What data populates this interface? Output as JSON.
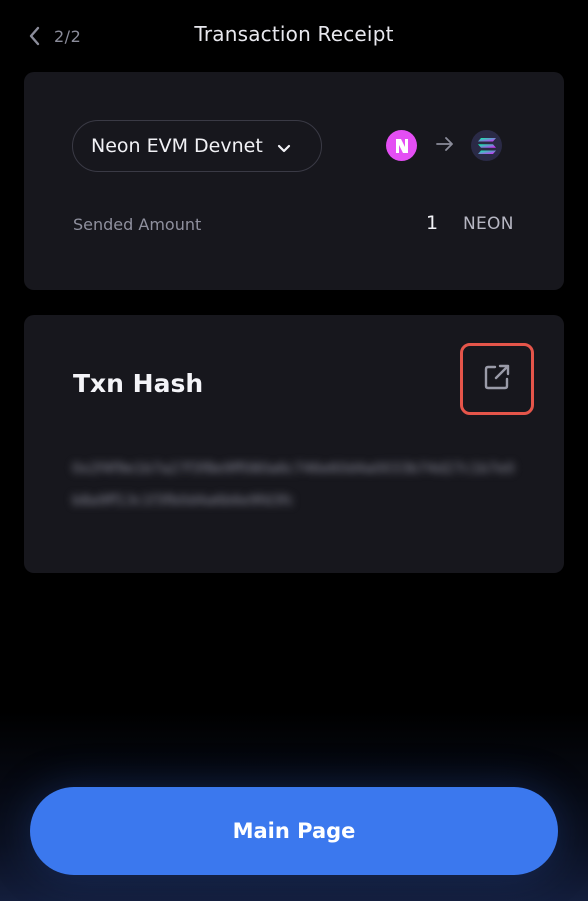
{
  "header": {
    "step": "2/2",
    "title": "Transaction Receipt"
  },
  "network_card": {
    "network_name": "Neon EVM Devnet",
    "from_token_icon": "neon-logo-icon",
    "to_token_icon": "solana-logo-icon",
    "amount_label": "Sended Amount",
    "amount_value": "1",
    "amount_unit": "NEON"
  },
  "hash_card": {
    "title": "Txn Hash",
    "hash": "0x2f4f9e1b7a27f3f8e9ff080a6c746e60d4a0033b74d27c1b7e0b8a9ff13c1f3fb0d4a6b6e9fd3fc",
    "hash_blurred": true
  },
  "footer": {
    "main_button_label": "Main Page"
  },
  "colors": {
    "background": "#000000",
    "card": "#17171d",
    "accent_button": "#3b78ee",
    "highlight_border": "#e5554a",
    "neon_token": "#e44ef4"
  }
}
